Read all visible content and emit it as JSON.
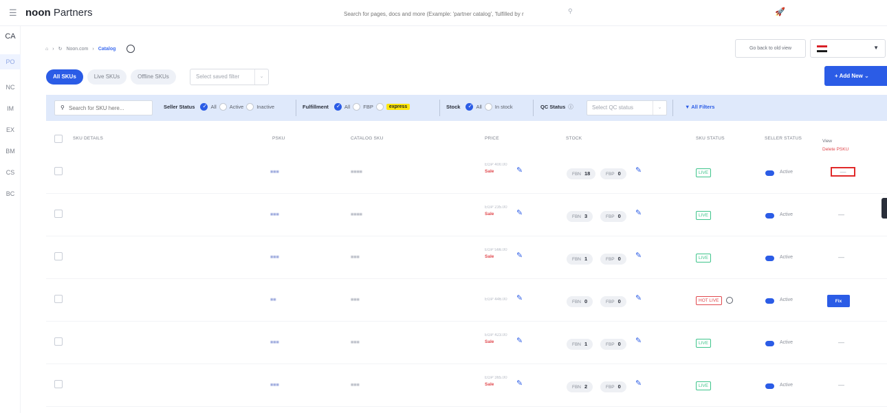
{
  "header": {
    "brand_bold": "noon",
    "brand_rest": " Partners",
    "search_placeholder": "Search for pages, docs and more (Example: 'partner catalog', 'fulfilled by r",
    "rocket_icon": "rocket-icon"
  },
  "sidenav": [
    "CA",
    "PO",
    "NC",
    "IM",
    "EX",
    "BM",
    "CS",
    "BC"
  ],
  "breadcrumb": {
    "site": "Noon.com",
    "current": "Catalog"
  },
  "top_actions": {
    "old_view": "Go back to old view",
    "country_flag_colors": [
      "#d91f26",
      "#ffffff",
      "#1b1b1b"
    ]
  },
  "tabs": [
    "All SKUs",
    "Live SKUs",
    "Offline SKUs"
  ],
  "saved_filter_placeholder": "Select saved filter",
  "add_new": "+ Add New",
  "filters": {
    "sku_search_placeholder": "Search for SKU here...",
    "seller_status": {
      "label": "Seller Status",
      "options": [
        "All",
        "Active",
        "Inactive"
      ]
    },
    "fulfillment": {
      "label": "Fulfillment",
      "options": [
        "All",
        "FBP",
        "express"
      ]
    },
    "stock": {
      "label": "Stock",
      "options": [
        "All",
        "In stock"
      ]
    },
    "qc_status": {
      "label": "QC Status",
      "placeholder": "Select QC status"
    },
    "all_filters": "All Filters"
  },
  "table": {
    "headers": {
      "sku_details": "SKU DETAILS",
      "psku": "PSKU",
      "catalog_sku": "CATALOG SKU",
      "price": "PRICE",
      "stock": "STOCK",
      "sku_status": "SKU STATUS",
      "seller_status": "SELLER STATUS"
    },
    "view_label": "View",
    "delete_label": "Delete PSKU",
    "fbn_label": "FBN",
    "fbp_label": "FBP",
    "sale_label": "Sale",
    "active_label": "Active",
    "fix_label": "Fix",
    "rows": [
      {
        "psku": "■■■",
        "catalog_sku": "■■■■",
        "price": "EGP 400.00",
        "sale": true,
        "fbn": "18",
        "fbp": "0",
        "sku_status": "LIVE",
        "action": "—"
      },
      {
        "psku": "■■■",
        "catalog_sku": "■■■■",
        "price": "EGP 235.00",
        "sale": true,
        "fbn": "3",
        "fbp": "0",
        "sku_status": "LIVE",
        "action": "—"
      },
      {
        "psku": "■■■",
        "catalog_sku": "■■■",
        "price": "EGP 566.00",
        "sale": true,
        "fbn": "1",
        "fbp": "0",
        "sku_status": "LIVE",
        "action": "—"
      },
      {
        "psku": "■■",
        "catalog_sku": "■■■",
        "price": "EGP 446.00",
        "sale": false,
        "fbn": "0",
        "fbp": "0",
        "sku_status": "HOT LIVE",
        "action": "Fix"
      },
      {
        "psku": "■■■",
        "catalog_sku": "■■■",
        "price": "EGP 423.00",
        "sale": true,
        "fbn": "1",
        "fbp": "0",
        "sku_status": "LIVE",
        "action": "—"
      },
      {
        "psku": "■■■",
        "catalog_sku": "■■■",
        "price": "EGP 365.00",
        "sale": true,
        "fbn": "2",
        "fbp": "0",
        "sku_status": "LIVE",
        "action": "—"
      }
    ]
  }
}
